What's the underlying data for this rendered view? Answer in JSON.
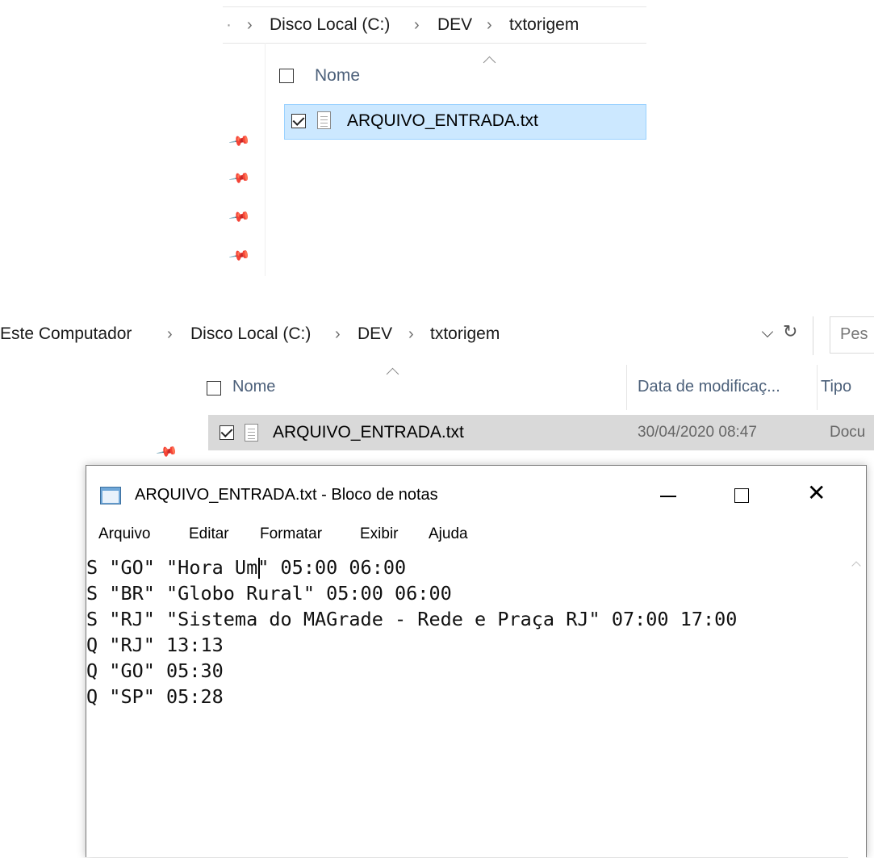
{
  "explorer_top": {
    "breadcrumb": {
      "lead_glyph": "·",
      "items": [
        "Disco Local (C:)",
        "DEV",
        "txtorigem"
      ],
      "separator": "›"
    },
    "column_name": "Nome",
    "file": {
      "name": "ARQUIVO_ENTRADA.txt",
      "checked": true,
      "selected": true
    }
  },
  "explorer_main": {
    "breadcrumb": {
      "items": [
        "Este Computador",
        "Disco Local (C:)",
        "DEV",
        "txtorigem"
      ],
      "separator": "›"
    },
    "search_placeholder": "Pes",
    "columns": {
      "name": "Nome",
      "date": "Data de modificaç...",
      "type": "Tipo"
    },
    "file": {
      "name": "ARQUIVO_ENTRADA.txt",
      "date": "30/04/2020 08:47",
      "type": "Docu",
      "checked": true
    }
  },
  "notepad": {
    "title": "ARQUIVO_ENTRADA.txt - Bloco de notas",
    "menu": [
      "Arquivo",
      "Editar",
      "Formatar",
      "Exibir",
      "Ajuda"
    ],
    "lines": [
      "S \"GO\" \"Hora Um\" 05:00 06:00",
      "S \"BR\" \"Globo Rural\" 05:00 06:00",
      "S \"RJ\" \"Sistema do MAGrade - Rede e Praça RJ\" 07:00 17:00",
      "Q \"RJ\" 13:13",
      "Q \"GO\" 05:30",
      "Q \"SP\" 05:28"
    ],
    "caret_after": "S \"GO\" \"Hora Um"
  },
  "colors": {
    "selected_row_blue": "#cce8ff",
    "selected_row_border": "#99d1ff",
    "selected_row_gray": "#d9d9d9",
    "header_text": "#4c607a"
  }
}
